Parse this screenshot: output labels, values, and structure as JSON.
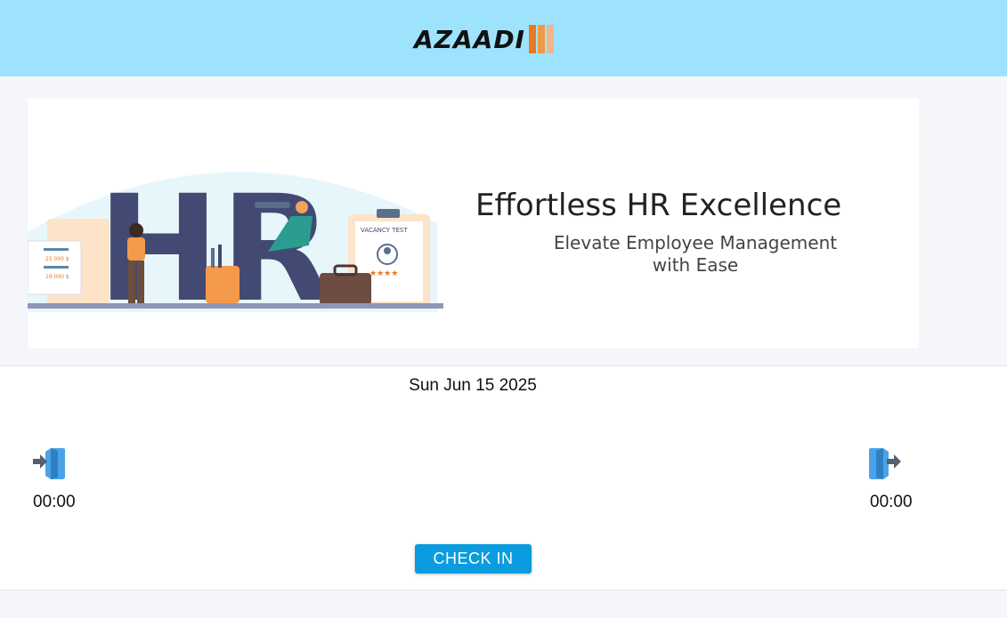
{
  "header": {
    "brand": "AZAADI",
    "bar_colors": [
      "#e8791f",
      "#ee9a45",
      "#f2b784"
    ]
  },
  "banner": {
    "title": "Effortless HR Excellence",
    "subtitle_line1": "Elevate Employee Management",
    "subtitle_line2": "with Ease",
    "illustration_text": "HR",
    "vacancy_label": "VACANCY TEST",
    "figure_a": "25 000 $",
    "figure_b": "19 000 $"
  },
  "attendance": {
    "date": "Sun Jun 15 2025",
    "check_in_time": "00:00",
    "check_out_time": "00:00",
    "button_label": "CHECK IN",
    "accent": "#0a9cdf"
  },
  "icons": {
    "check_in": "login-door-icon",
    "check_out": "logout-door-icon"
  }
}
